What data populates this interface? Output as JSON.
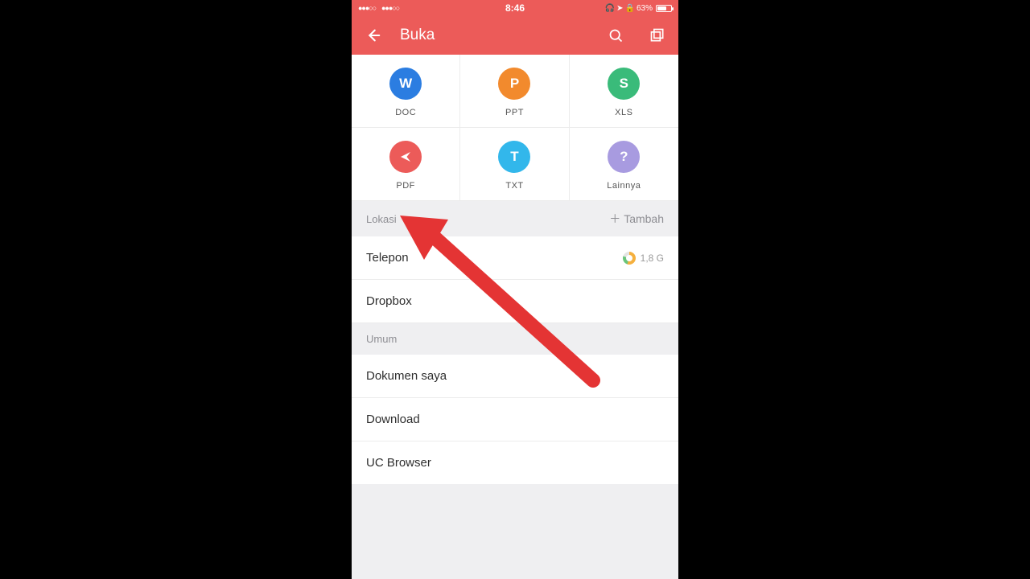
{
  "statusbar": {
    "time": "8:46",
    "battery_pct": "63%"
  },
  "appbar": {
    "title": "Buka"
  },
  "filetypes": [
    {
      "letter": "W",
      "label": "DOC",
      "color": "c-blue"
    },
    {
      "letter": "P",
      "label": "PPT",
      "color": "c-orange"
    },
    {
      "letter": "S",
      "label": "XLS",
      "color": "c-green"
    },
    {
      "letter": "",
      "label": "PDF",
      "color": "c-red"
    },
    {
      "letter": "T",
      "label": "TXT",
      "color": "c-sky"
    },
    {
      "letter": "?",
      "label": "Lainnya",
      "color": "c-lilac"
    }
  ],
  "sections": {
    "lokasi_label": "Lokasi",
    "tambah_label": "Tambah",
    "umum_label": "Umum"
  },
  "locations": [
    {
      "name": "Telepon",
      "size": "1,8 G"
    },
    {
      "name": "Dropbox",
      "size": ""
    }
  ],
  "common": [
    {
      "name": "Dokumen saya"
    },
    {
      "name": "Download"
    },
    {
      "name": "UC Browser"
    }
  ]
}
